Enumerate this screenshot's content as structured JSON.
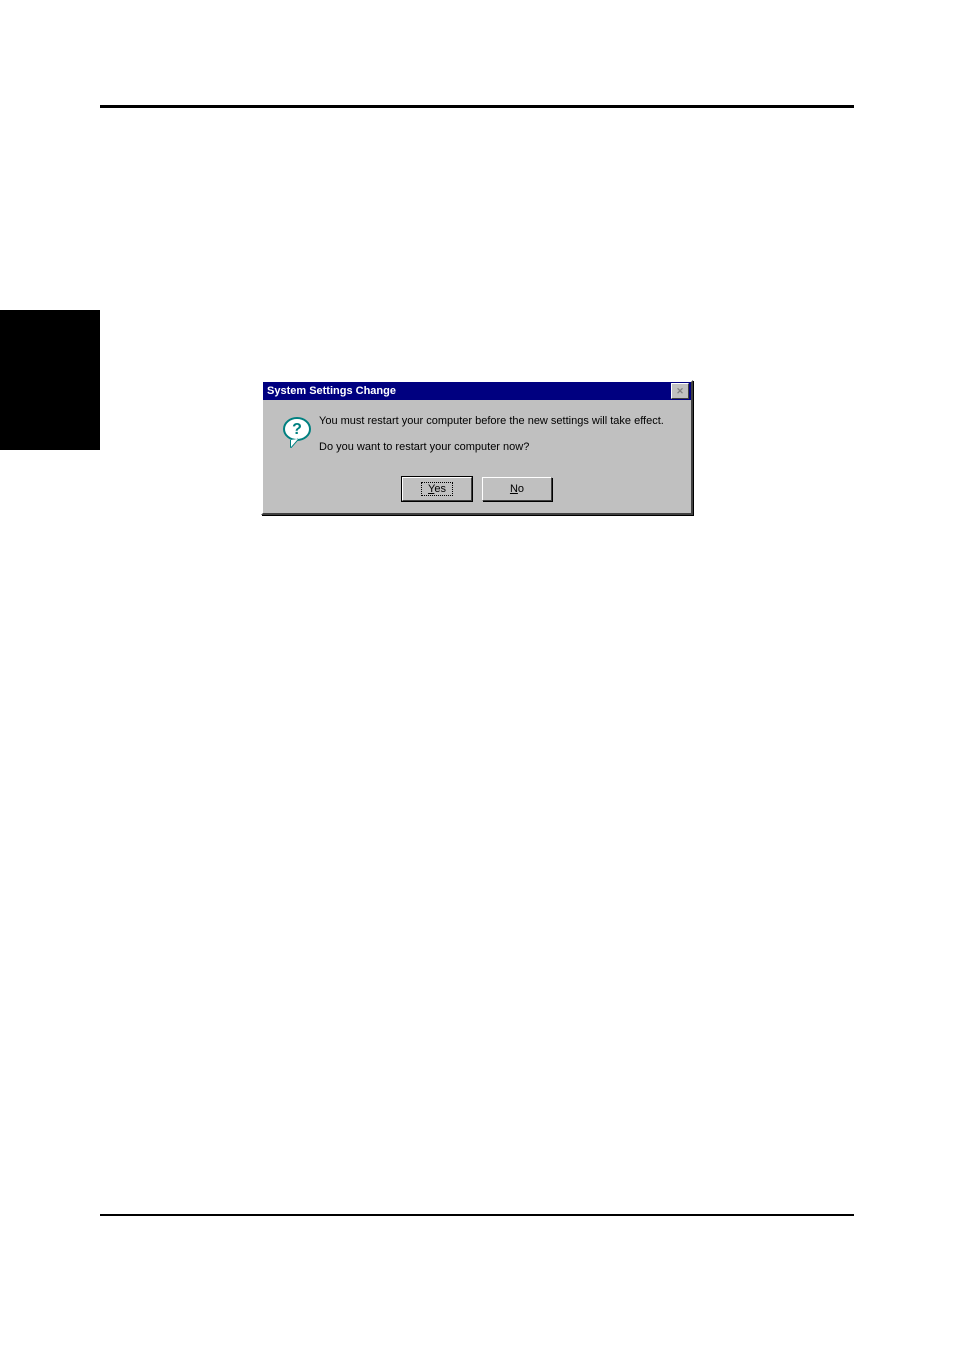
{
  "dialog": {
    "title": "System Settings Change",
    "message_line1": "You must restart your computer before the new settings will take effect.",
    "message_line2": "Do you want to restart your computer now?",
    "buttons": {
      "yes": "Yes",
      "no": "No"
    },
    "close_glyph": "✕"
  }
}
